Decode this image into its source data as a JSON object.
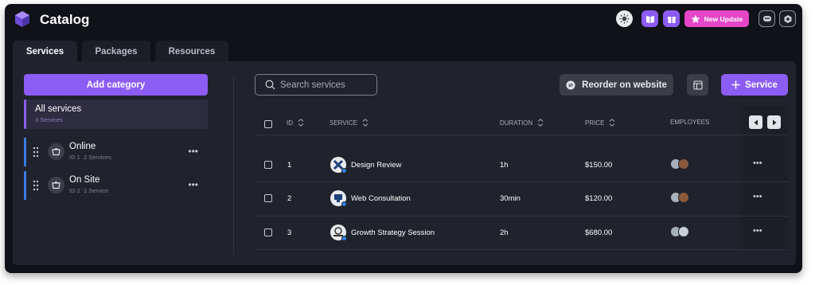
{
  "app": {
    "title": "Catalog"
  },
  "header": {
    "new_update_label": "New Update"
  },
  "tabs": [
    {
      "label": "Services",
      "active": true
    },
    {
      "label": "Packages",
      "active": false
    },
    {
      "label": "Resources",
      "active": false
    }
  ],
  "sidebar": {
    "add_category_label": "Add category",
    "all_services": {
      "label": "All services",
      "count": "3 Services"
    },
    "categories": [
      {
        "name": "Online",
        "id_text": "ID 1",
        "services_text": "2 Services"
      },
      {
        "name": "On Site",
        "id_text": "ID 2",
        "services_text": "1 Service"
      }
    ]
  },
  "toolbar": {
    "search_placeholder": "Search services",
    "reorder_label": "Reorder on website",
    "add_service_label": "Service"
  },
  "table": {
    "headers": {
      "id": "ID",
      "service": "SERVICE",
      "duration": "DURATION",
      "price": "PRICE",
      "employees": "EMPLOYEES"
    },
    "rows": [
      {
        "id": "1",
        "service": "Design Review",
        "duration": "1h",
        "price": "$150.00"
      },
      {
        "id": "2",
        "service": "Web Consultation",
        "duration": "30min",
        "price": "$120.00"
      },
      {
        "id": "3",
        "service": "Growth Strategy Session",
        "duration": "2h",
        "price": "$680.00"
      }
    ]
  },
  "colors": {
    "accent": "#8d5cf5",
    "pink": "#e546c8",
    "blue": "#3a7ae6",
    "background": "#101217",
    "panel": "#20232b"
  },
  "icons": [
    "logo-icon",
    "theme-toggle-icon",
    "book-icon",
    "gift-icon",
    "star-icon",
    "chat-icon",
    "settings-icon",
    "search-icon",
    "reorder-icon",
    "columns-icon",
    "plus-icon",
    "drag-handle-icon",
    "category-icon",
    "chevron-left-icon",
    "chevron-right-icon",
    "sort-icon",
    "more-icon"
  ]
}
